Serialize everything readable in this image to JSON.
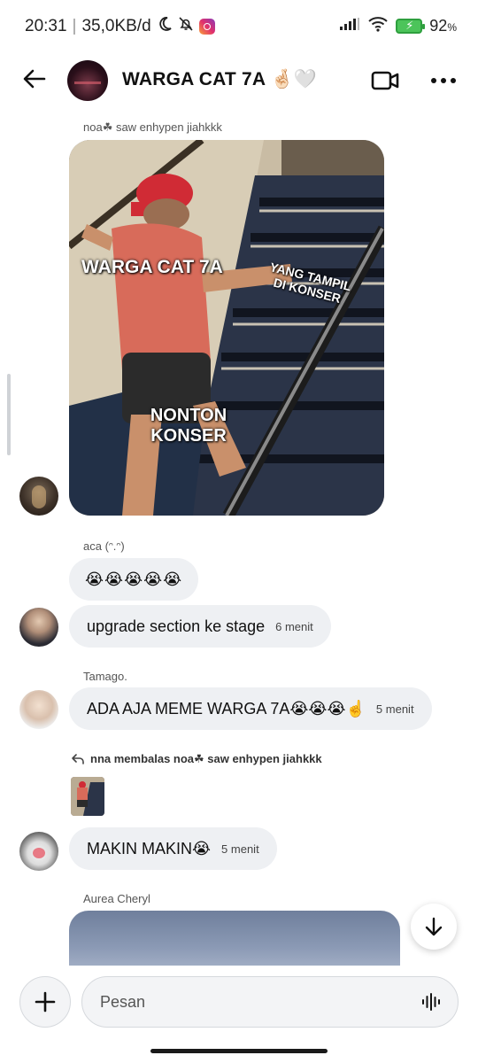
{
  "status_bar": {
    "time": "20:31",
    "network_speed": "35,0KB/d",
    "battery_percent": "92",
    "battery_unit": "%",
    "icons": [
      "moon-icon",
      "bell-off-icon",
      "instagram-icon",
      "signal-icon",
      "wifi-icon",
      "battery-icon"
    ]
  },
  "header": {
    "title": "WARGA CAT 7A 🤞🏻🤍",
    "icons": [
      "back-arrow-icon",
      "video-call-icon",
      "more-icon"
    ]
  },
  "messages": [
    {
      "sender": "noa☘︎ saw enhypen jiahkkk",
      "type": "image",
      "image_captions": [
        "WARGA CAT 7A",
        "YANG TAMPIL DI KONSER",
        "NONTON KONSER"
      ]
    },
    {
      "sender": "aca (ᵔ.ᵔ)",
      "text": "😭😭😭😭😭"
    },
    {
      "text": "upgrade section ke stage",
      "time": "6 menit"
    },
    {
      "sender": "Tamago.",
      "text": "ADA AJA MEME WARGA 7A😭😭😭☝️",
      "time": "5 menit"
    },
    {
      "reply_label": "nna membalas noa☘︎ saw enhypen jiahkkk",
      "text": "MAKIN MAKIN😭",
      "time": "5 menit"
    },
    {
      "sender": "Aurea Cheryl",
      "type": "image"
    }
  ],
  "composer": {
    "placeholder": "Pesan",
    "icons": [
      "plus-icon",
      "voice-wave-icon"
    ]
  },
  "scroll_down_icon": "arrow-down-icon"
}
